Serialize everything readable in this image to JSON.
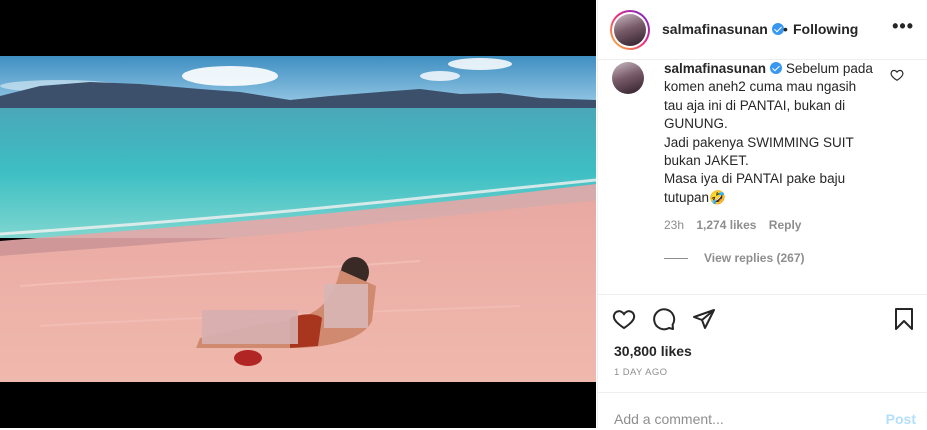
{
  "header": {
    "username": "salmafinasunan",
    "separator": "•",
    "follow_label": "Following",
    "more_label": "•••"
  },
  "comment": {
    "username": "salmafinasunan",
    "lines": [
      "Sebelum pada",
      "komen aneh2 cuma mau ngasih",
      "tau aja ini di PANTAI, bukan di",
      "GUNUNG.",
      "Jadi pakenya SWIMMING SUIT",
      "bukan JAKET.",
      "Masa iya di PANTAI pake baju",
      "tutupan🤣"
    ],
    "age": "23h",
    "likes": "1,274 likes",
    "reply_label": "Reply",
    "view_replies": "View replies (267)"
  },
  "post": {
    "likes": "30,800 likes",
    "time": "1 DAY AGO"
  },
  "composer": {
    "placeholder": "Add a comment...",
    "post_label": "Post"
  },
  "icons": {
    "like": "heart-icon",
    "comment": "comment-icon",
    "share": "share-icon",
    "save": "bookmark-icon",
    "verified": "verified-badge-icon",
    "more": "more-options-icon"
  }
}
